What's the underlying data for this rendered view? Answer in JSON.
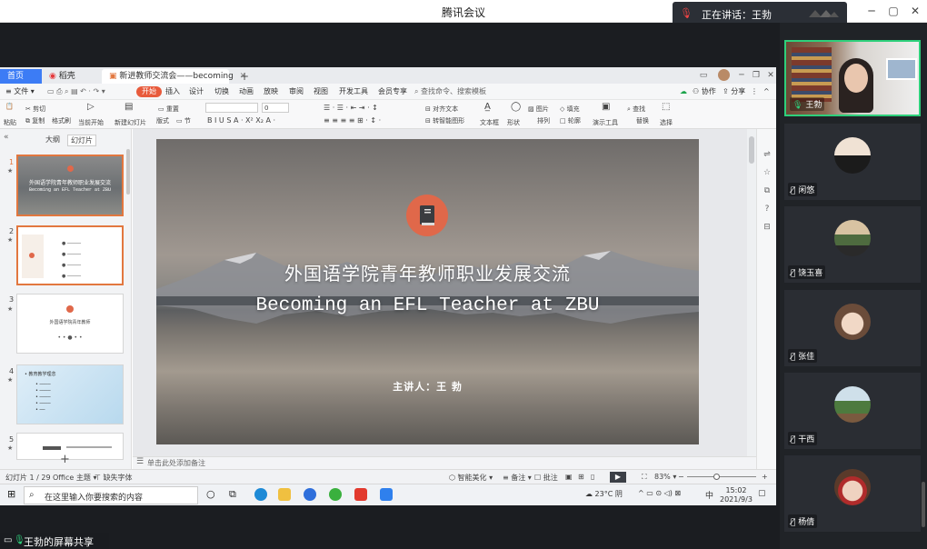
{
  "meeting": {
    "app_title": "腾讯会议",
    "speaking_prefix": "正在讲话：王勃",
    "screen_share_label": "王勃的屏幕共享"
  },
  "participants": [
    {
      "name": "王勃"
    },
    {
      "name": "闲悠"
    },
    {
      "name": "饶玉喜"
    },
    {
      "name": "张佳"
    },
    {
      "name": "干西"
    },
    {
      "name": "杨倩"
    }
  ],
  "wps": {
    "tabs": {
      "home": "首页",
      "daoke": "稻壳",
      "doc": "新进教师交流会——becoming",
      "add": "+"
    },
    "menu": [
      "文件",
      "开始",
      "插入",
      "设计",
      "切换",
      "动画",
      "放映",
      "审阅",
      "视图",
      "开发工具",
      "会员专享"
    ],
    "search_placeholder": "查找命令、搜索模板",
    "right_menu": {
      "collab": "协作",
      "share": "分享"
    },
    "ribbon": {
      "paste": "粘贴",
      "cut": "剪切",
      "copy": "复制",
      "format_painter": "格式刷",
      "from_current": "当前开始",
      "new_slide": "新建幻灯片",
      "layout": "版式",
      "section": "节",
      "reset": "重置",
      "font_size": "0",
      "text_box": "文本框",
      "shape": "形状",
      "arrange": "排列",
      "picture": "图片",
      "fill": "填充",
      "outline": "轮廓",
      "presentation_tool": "演示工具",
      "replace": "替换",
      "find": "查找",
      "select": "选择",
      "align_text": "对齐文本",
      "smartart": "转智能图形"
    },
    "sidebar": {
      "tab_outline": "大纲",
      "tab_slides": "幻灯片",
      "thumbs": [
        {
          "num": "1",
          "title": "外国语学院青年教师职业发展交流",
          "sub": "Becoming an EFL Teacher at ZBU"
        },
        {
          "num": "2"
        },
        {
          "num": "3",
          "title": "外国语学院青年教师"
        },
        {
          "num": "4",
          "title": "• 教育教学理念"
        },
        {
          "num": "5"
        }
      ]
    },
    "slide": {
      "title_cn": "外国语学院青年教师职业发展交流",
      "title_en": "Becoming an EFL Teacher at ZBU",
      "presenter": "主讲人：王  勃"
    },
    "notes_placeholder": "单击此处添加备注",
    "status": {
      "slide_counter": "幻灯片 1 / 29",
      "theme": "Office 主题",
      "font_missing": "缺失字体",
      "beautify": "智能美化",
      "notes": "备注",
      "comment": "批注",
      "zoom": "83%"
    }
  },
  "taskbar": {
    "search_placeholder": "在这里输入你要搜索的内容",
    "weather": "23°C 阴",
    "ime": "中",
    "time": "15:02",
    "date": "2021/9/3"
  }
}
